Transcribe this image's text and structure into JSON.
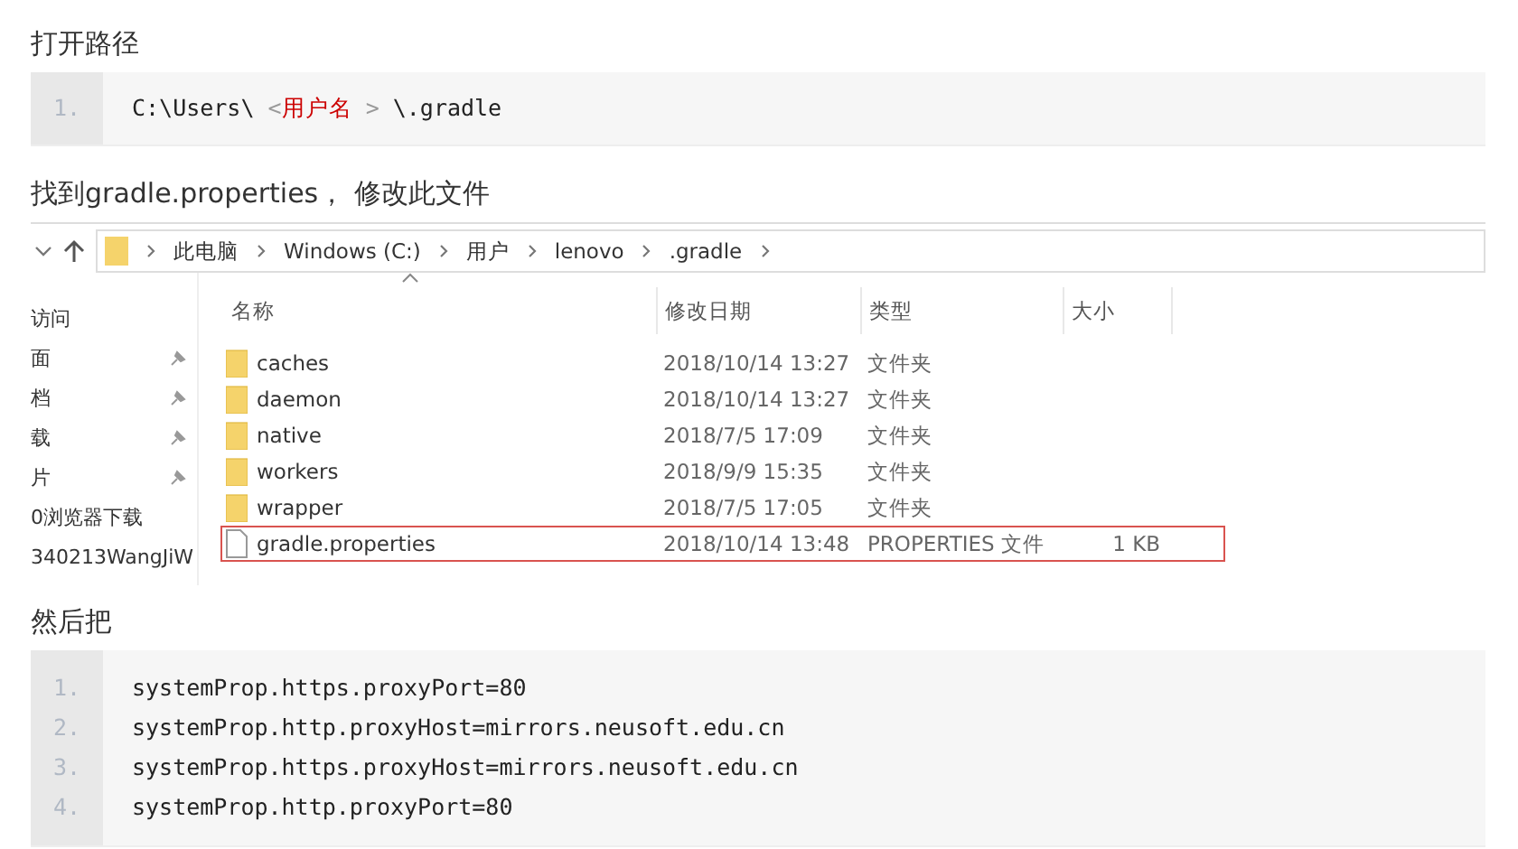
{
  "sections": [
    {
      "heading": "打开路径",
      "code": [
        {
          "number": "1.",
          "parts": [
            {
              "text": "C:\\Users\\ ",
              "kind": "plain"
            },
            {
              "text": "<",
              "kind": "muted"
            },
            {
              "text": "用户名",
              "kind": "red"
            },
            {
              "text": " > ",
              "kind": "muted"
            },
            {
              "text": "\\.gradle",
              "kind": "plain"
            }
          ]
        }
      ]
    },
    {
      "heading": "找到gradle.properties， 修改此文件",
      "explorer": {
        "breadcrumb": [
          "此电脑",
          "Windows (C:)",
          "用户",
          "lenovo",
          ".gradle"
        ],
        "sidebar": [
          {
            "label": "访问",
            "pinned": false
          },
          {
            "label": "面",
            "pinned": true
          },
          {
            "label": "档",
            "pinned": true
          },
          {
            "label": "载",
            "pinned": true
          },
          {
            "label": "片",
            "pinned": true
          },
          {
            "label": "0浏览器下载",
            "pinned": false
          },
          {
            "label": "340213WangJiW",
            "pinned": false
          }
        ],
        "columns": [
          "名称",
          "修改日期",
          "类型",
          "大小"
        ],
        "files": [
          {
            "kind": "folder",
            "name": "caches",
            "modified": "2018/10/14 13:27",
            "type": "文件夹",
            "highlighted": false
          },
          {
            "kind": "folder",
            "name": "daemon",
            "modified": "2018/10/14 13:27",
            "type": "文件夹",
            "highlighted": false
          },
          {
            "kind": "folder",
            "name": "native",
            "modified": "2018/7/5 17:09",
            "type": "文件夹",
            "highlighted": false
          },
          {
            "kind": "folder",
            "name": "workers",
            "modified": "2018/9/9 15:35",
            "type": "文件夹",
            "highlighted": false
          },
          {
            "kind": "folder",
            "name": "wrapper",
            "modified": "2018/7/5 17:05",
            "type": "文件夹",
            "highlighted": false
          },
          {
            "kind": "file",
            "name": "gradle.properties",
            "modified": "2018/10/14 13:48",
            "type": "PROPERTIES 文件",
            "size": "1 KB",
            "highlighted": true
          }
        ]
      }
    },
    {
      "heading": "然后把",
      "code": [
        {
          "number": "1.",
          "parts": [
            {
              "text": "systemProp.https.proxyPort=80",
              "kind": "plain"
            }
          ]
        },
        {
          "number": "2.",
          "parts": [
            {
              "text": "systemProp.http.proxyHost=mirrors.neusoft.edu.cn",
              "kind": "plain"
            }
          ]
        },
        {
          "number": "3.",
          "parts": [
            {
              "text": "systemProp.https.proxyHost=mirrors.neusoft.edu.cn",
              "kind": "plain"
            }
          ]
        },
        {
          "number": "4.",
          "parts": [
            {
              "text": "systemProp.http.proxyPort=80",
              "kind": "plain"
            }
          ]
        }
      ]
    }
  ]
}
